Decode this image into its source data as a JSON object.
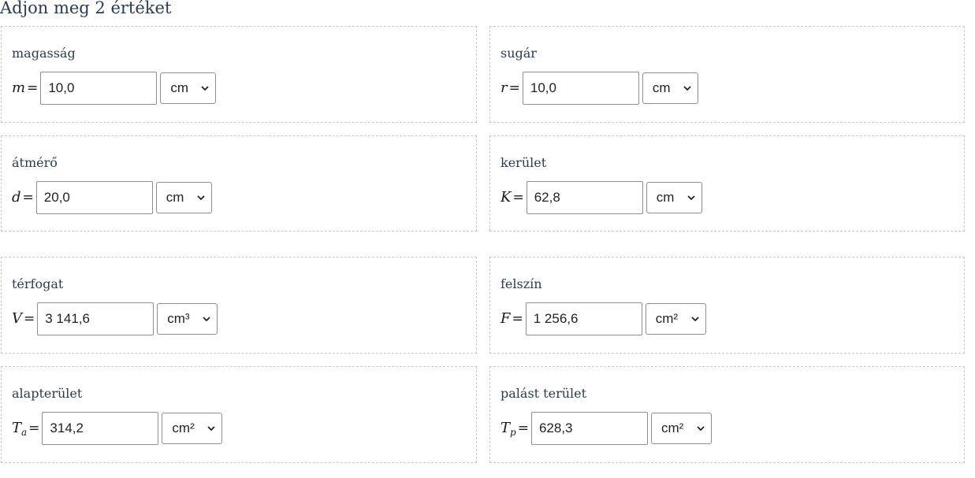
{
  "heading": "Adjon meg 2 értéket",
  "fields": {
    "height": {
      "label": "magasság",
      "symbol": "m",
      "sub": "",
      "value": "10,0",
      "unit": "cm"
    },
    "radius": {
      "label": "sugár",
      "symbol": "r",
      "sub": "",
      "value": "10,0",
      "unit": "cm"
    },
    "diameter": {
      "label": "átmérő",
      "symbol": "d",
      "sub": "",
      "value": "20,0",
      "unit": "cm"
    },
    "perimeter": {
      "label": "kerület",
      "symbol": "K",
      "sub": "",
      "value": "62,8",
      "unit": "cm"
    },
    "volume": {
      "label": "térfogat",
      "symbol": "V",
      "sub": "",
      "value": "3 141,6",
      "unit": "cm³"
    },
    "surface": {
      "label": "felszín",
      "symbol": "F",
      "sub": "",
      "value": "1 256,6",
      "unit": "cm²"
    },
    "base_area": {
      "label": "alapterület",
      "symbol": "T",
      "sub": "a",
      "value": "314,2",
      "unit": "cm²"
    },
    "lateral_area": {
      "label": "palást terület",
      "symbol": "T",
      "sub": "p",
      "value": "628,3",
      "unit": "cm²"
    }
  },
  "equals": "=",
  "icons": {
    "select_arrow": "chevron-down-icon"
  }
}
